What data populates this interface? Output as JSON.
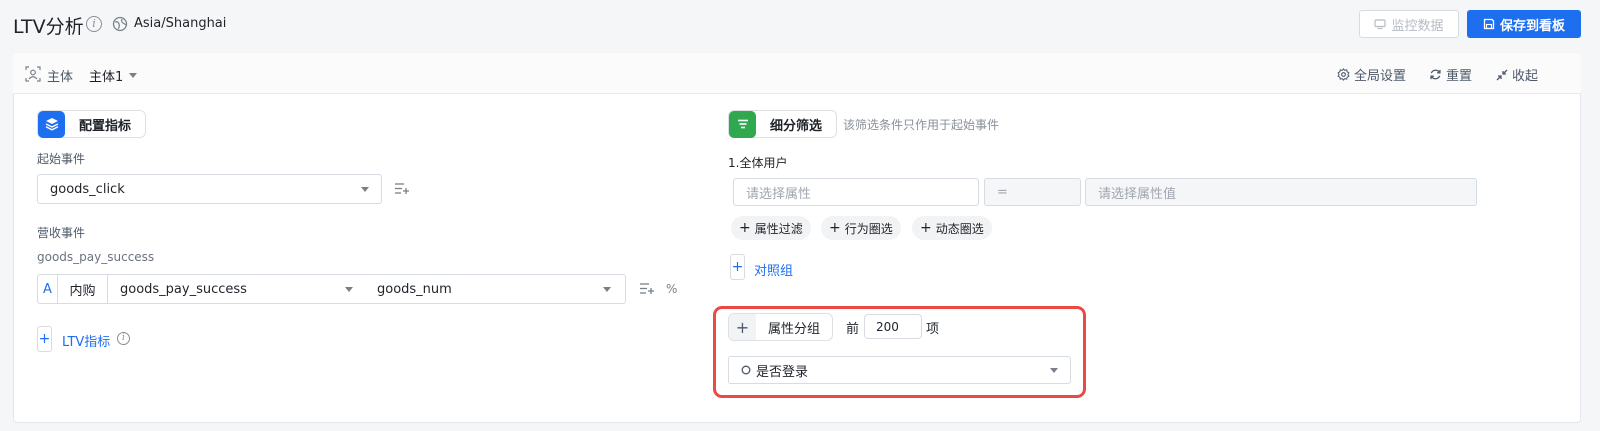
{
  "header": {
    "title": "LTV分析",
    "info_icon": "info-icon",
    "timezone_icon": "globe-icon",
    "timezone": "Asia/Shanghai",
    "monitor_label": "监控数据",
    "save_label": "保存到看板"
  },
  "subject": {
    "icon": "user-scan-icon",
    "label": "主体",
    "value": "主体1",
    "actions": {
      "global_settings": "全局设置",
      "reset": "重置",
      "collapse": "收起"
    }
  },
  "metrics": {
    "section_label": "配置指标",
    "start_event_label": "起始事件",
    "start_event_value": "goods_click",
    "revenue_event_label": "营收事件",
    "revenue_event_name": "goods_pay_success",
    "revenue_row": {
      "type_badge": "A",
      "type_label": "内购",
      "event": "goods_pay_success",
      "property": "goods_num",
      "percent": "%"
    },
    "ltv_add_label": "LTV指标"
  },
  "filter": {
    "section_label": "细分筛选",
    "hint": "该筛选条件只作用于起始事件",
    "group_label": "1.全体用户",
    "property_placeholder": "请选择属性",
    "operator": "=",
    "value_placeholder": "请选择属性值",
    "chips": [
      "属性过滤",
      "行为圈选",
      "动态圈选"
    ],
    "compare_label": "对照组"
  },
  "grouping": {
    "label": "属性分组",
    "top_prefix": "前",
    "top_value": "200",
    "top_suffix": "项",
    "group_by_value": "是否登录"
  },
  "colors": {
    "primary": "#1e6ff0",
    "metric_icon_bg": "#1e6ff0",
    "filter_icon_bg": "#2fa84f",
    "highlight": "#ea4a43"
  }
}
